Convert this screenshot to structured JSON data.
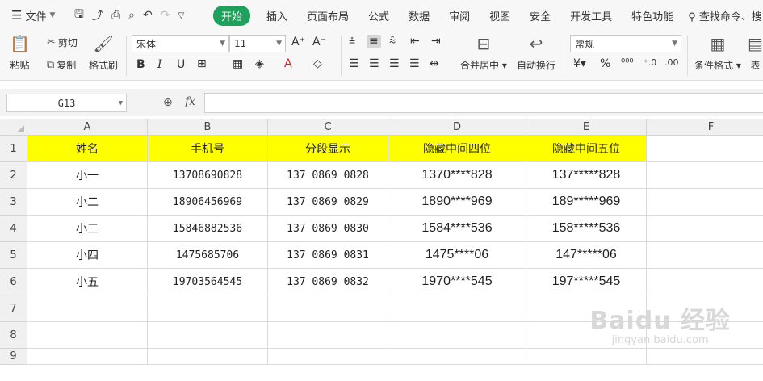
{
  "menubar": {
    "file_label": "文件",
    "tabs": [
      "开始",
      "插入",
      "页面布局",
      "公式",
      "数据",
      "审阅",
      "视图",
      "安全",
      "开发工具",
      "特色功能"
    ],
    "search_cmd": "查找命令、搜"
  },
  "ribbon": {
    "paste_label": "粘贴",
    "cut_label": "剪切",
    "copy_label": "复制",
    "format_painter_label": "格式刷",
    "font_name": "宋体",
    "font_size": "11",
    "merge_center_label": "合并居中",
    "wrap_text_label": "自动换行",
    "number_format": "常规",
    "conditional_format_label": "条件格式",
    "table_label": "表"
  },
  "formula_bar": {
    "name_box": "G13",
    "fx": "fx",
    "formula": ""
  },
  "columns": [
    "A",
    "B",
    "C",
    "D",
    "E",
    "F"
  ],
  "rows": [
    "1",
    "2",
    "3",
    "4",
    "5",
    "6",
    "7",
    "8",
    "9"
  ],
  "table": {
    "headers": [
      "姓名",
      "手机号",
      "分段显示",
      "隐藏中间四位",
      "隐藏中间五位"
    ],
    "data": [
      [
        "小一",
        "13708690828",
        "137 0869 0828",
        "1370****828",
        "137*****828"
      ],
      [
        "小二",
        "18906456969",
        "137 0869 0829",
        "1890****969",
        "189*****969"
      ],
      [
        "小三",
        "15846882536",
        "137 0869 0830",
        "1584****536",
        "158*****536"
      ],
      [
        "小四",
        "1475685706",
        "137 0869 0831",
        "1475****06",
        "147*****06"
      ],
      [
        "小五",
        "19703564545",
        "137 0869 0832",
        "1970****545",
        "197*****545"
      ]
    ]
  },
  "watermark": {
    "brand": "Baidu 经验",
    "url": "jingyan.baidu.com"
  },
  "colors": {
    "accent": "#1fa15d",
    "header_fill": "#ffff00"
  }
}
